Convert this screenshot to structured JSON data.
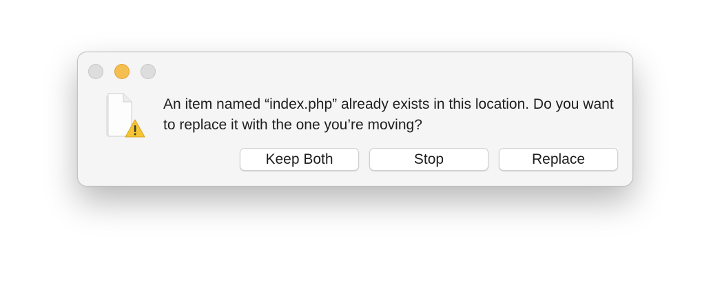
{
  "window": {
    "traffic_lights": [
      {
        "name": "close",
        "color": "#dddddd"
      },
      {
        "name": "minimize",
        "color": "#f5bf4f"
      },
      {
        "name": "zoom",
        "color": "#dddddd"
      }
    ]
  },
  "dialog": {
    "icon": "document-warning-icon",
    "message": "An item named “index.php” already exists in this location. Do you want to replace it with the one you’re moving?",
    "buttons": {
      "keep_both": "Keep Both",
      "stop": "Stop",
      "replace": "Replace"
    }
  },
  "colors": {
    "dialog_background": "#f5f5f5",
    "warning": "#f5c533"
  }
}
